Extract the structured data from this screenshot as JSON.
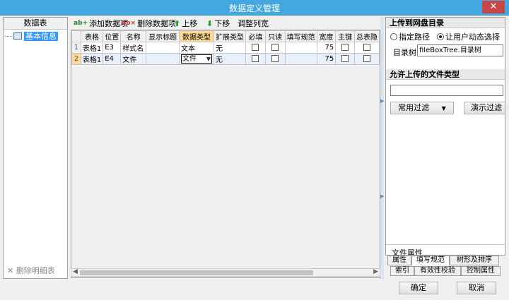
{
  "window": {
    "title": "数据定义管理",
    "close_label": "✕"
  },
  "left_panel": {
    "header": "数据表",
    "tree_item": "基本信息",
    "delete_detail": "删除明细表"
  },
  "toolbar": {
    "add_item": "添加数据项",
    "delete_item": "删除数据项",
    "move_up": "上移",
    "move_down": "下移",
    "adjust_width": "调整列宽"
  },
  "grid": {
    "columns": [
      "",
      "表格",
      "位置",
      "名称",
      "显示标题",
      "数据类型",
      "扩展类型",
      "必填",
      "只读",
      "填写规范",
      "宽度",
      "主键",
      "总表隐"
    ],
    "rows": [
      {
        "num": "1",
        "table": "表格1",
        "pos": "E3",
        "name": "样式名",
        "title": "",
        "dtype": "文本",
        "ext": "无",
        "width": "75"
      },
      {
        "num": "2",
        "table": "表格1",
        "pos": "E4",
        "name": "文件",
        "title": "",
        "dtype": "文件",
        "ext": "无",
        "width": "75"
      }
    ]
  },
  "right_panel": {
    "upload_header": "上传到网盘目录",
    "radio_fixed": "指定路径",
    "radio_dynamic": "让用户动态选择",
    "dir_label": "目录树",
    "dir_value": "fileBoxTree.目录树",
    "allowed_header": "允许上传的文件类型",
    "common_filter": "常用过滤",
    "demo_filter": "演示过滤",
    "file_props": "文件属性"
  },
  "tabs": {
    "row1": [
      "属性",
      "填写规范",
      "树形及排序"
    ],
    "row2": [
      "索引",
      "有效性校验",
      "控制属性"
    ]
  },
  "footer": {
    "ok": "确定",
    "cancel": "取消"
  }
}
